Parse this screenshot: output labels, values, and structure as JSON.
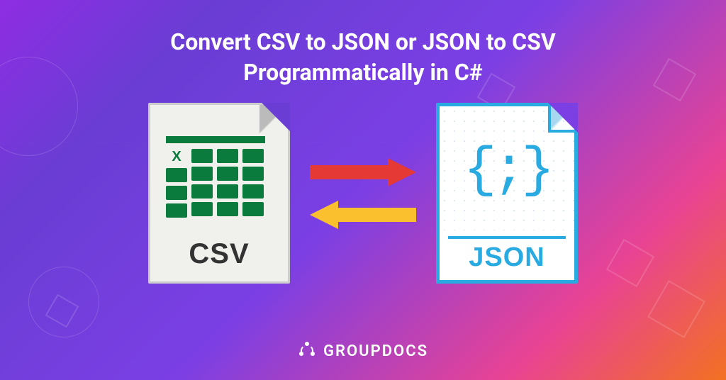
{
  "title_line1": "Convert CSV to JSON or JSON to CSV",
  "title_line2": "Programmatically in C#",
  "csv": {
    "label": "CSV",
    "xmark": "X"
  },
  "json": {
    "label": "JSON",
    "braces": "{;}"
  },
  "brand": "GROUPDOCS",
  "colors": {
    "arrow_right": "#e53935",
    "arrow_left": "#fbc02d",
    "csv_accent": "#0a7a3d",
    "json_accent": "#29abe2"
  }
}
